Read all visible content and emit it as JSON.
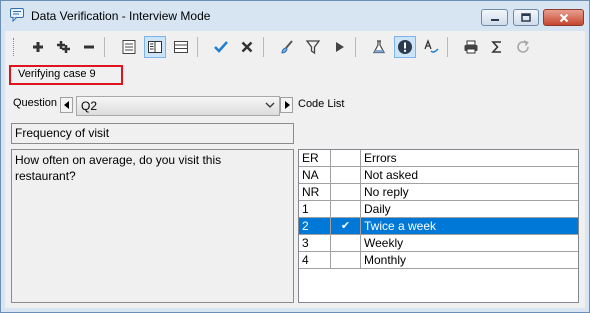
{
  "window": {
    "title": "Data Verification - Interview Mode",
    "icon": "speech-bubble-icon"
  },
  "toolbar": {
    "buttons": [
      {
        "icon": "add-icon",
        "glyph": "+"
      },
      {
        "icon": "add-multiple-icon",
        "glyph": "+"
      },
      {
        "icon": "remove-icon",
        "glyph": "−"
      },
      {
        "icon": "form-view-icon",
        "glyph": "▤"
      },
      {
        "icon": "split-view-icon",
        "glyph": "◫",
        "active": true
      },
      {
        "icon": "grid-view-icon",
        "glyph": "▦"
      },
      {
        "icon": "accept-icon",
        "glyph": "✔"
      },
      {
        "icon": "reject-icon",
        "glyph": "✖"
      },
      {
        "icon": "clear-brush-icon",
        "glyph": "✎"
      },
      {
        "icon": "filter-icon",
        "glyph": "⊽"
      },
      {
        "icon": "run-icon",
        "glyph": "▶"
      },
      {
        "icon": "flask-icon",
        "glyph": "⚗"
      },
      {
        "icon": "warning-icon",
        "glyph": "!",
        "active": true
      },
      {
        "icon": "spell-check-icon",
        "glyph": "A"
      },
      {
        "icon": "print-icon",
        "glyph": "⎙"
      },
      {
        "icon": "sum-icon",
        "glyph": "Σ"
      },
      {
        "icon": "refresh-icon",
        "glyph": "↻"
      }
    ]
  },
  "status": {
    "text": "Verifying case 9"
  },
  "question": {
    "label": "Question",
    "selected": "Q2",
    "title": "Frequency of visit",
    "text": "How often on average, do you visit this restaurant?"
  },
  "codelist": {
    "label": "Code List",
    "rows": [
      {
        "code": "ER",
        "check": "",
        "label": "Errors"
      },
      {
        "code": "NA",
        "check": "",
        "label": "Not asked"
      },
      {
        "code": "NR",
        "check": "",
        "label": "No reply"
      },
      {
        "code": "1",
        "check": "",
        "label": "Daily"
      },
      {
        "code": "2",
        "check": "✔",
        "label": "Twice a week",
        "selected": true
      },
      {
        "code": "3",
        "check": "",
        "label": "Weekly"
      },
      {
        "code": "4",
        "check": "",
        "label": "Monthly"
      }
    ]
  },
  "colors": {
    "selection": "#0078d7",
    "status_border": "#e0141e",
    "accept": "#1e7fd0",
    "warning_bg": "#2b3a4e"
  }
}
